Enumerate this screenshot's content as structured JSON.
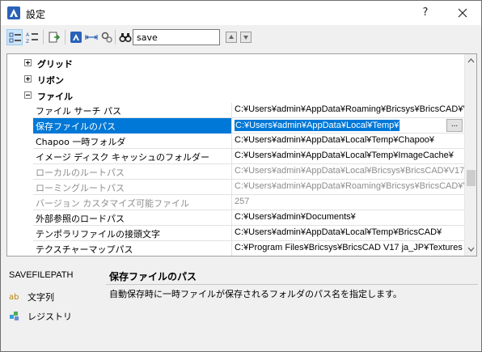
{
  "window": {
    "title": "設定",
    "help_label": "?"
  },
  "toolbar": {
    "search_value": "save",
    "icons": [
      "categorized-view-icon",
      "alphabetical-view-icon",
      "export-icon",
      "bricscad-icon",
      "fit-columns-icon",
      "properties-icon",
      "binoculars-icon",
      "previous-result-icon",
      "next-result-icon"
    ]
  },
  "grid": {
    "categories": [
      {
        "label": "グリッド",
        "expanded": false
      },
      {
        "label": "リボン",
        "expanded": false
      },
      {
        "label": "ファイル",
        "expanded": true
      }
    ],
    "rows": [
      {
        "name": "ファイル サーチ パス",
        "value": "C:¥Users¥admin¥AppData¥Roaming¥Bricsys¥BricsCAD¥V",
        "state": "normal"
      },
      {
        "name": "保存ファイルのパス",
        "value": "C:¥Users¥admin¥AppData¥Local¥Temp¥",
        "state": "selected",
        "button": "..."
      },
      {
        "name": "Chapoo 一時フォルダ",
        "value": "C:¥Users¥admin¥AppData¥Local¥Temp¥Chapoo¥",
        "state": "normal"
      },
      {
        "name": "イメージ ディスク キャッシュのフォルダー",
        "value": "C:¥Users¥admin¥AppData¥Local¥Temp¥ImageCache¥",
        "state": "normal"
      },
      {
        "name": "ローカルのルートパス",
        "value": "C:¥Users¥admin¥AppData¥Local¥Bricsys¥BricsCAD¥V17:",
        "state": "disabled"
      },
      {
        "name": "ローミングルートパス",
        "value": "C:¥Users¥admin¥AppData¥Roaming¥Bricsys¥BricsCAD¥V",
        "state": "disabled"
      },
      {
        "name": "バージョン カスタマイズ可能ファイル",
        "value": "257",
        "state": "disabled"
      },
      {
        "name": "外部参照のロードパス",
        "value": "C:¥Users¥admin¥Documents¥",
        "state": "normal"
      },
      {
        "name": "テンポラリファイルの接頭文字",
        "value": "C:¥Users¥admin¥AppData¥Local¥Temp¥BricsCAD¥",
        "state": "normal"
      },
      {
        "name": "テクスチャーマップパス",
        "value": "C:¥Program Files¥Bricsys¥BricsCAD V17 ja_JP¥Textures",
        "state": "normal"
      }
    ]
  },
  "description": {
    "variable_name": "SAVEFILEPATH",
    "type_label": "文字列",
    "storage_label": "レジストリ",
    "title": "保存ファイルのパス",
    "body": "自動保存時に一時ファイルが保存されるフォルダのパス名を指定します。"
  },
  "colors": {
    "selection": "#0078d7",
    "disabled_text": "#8d8d8d"
  }
}
